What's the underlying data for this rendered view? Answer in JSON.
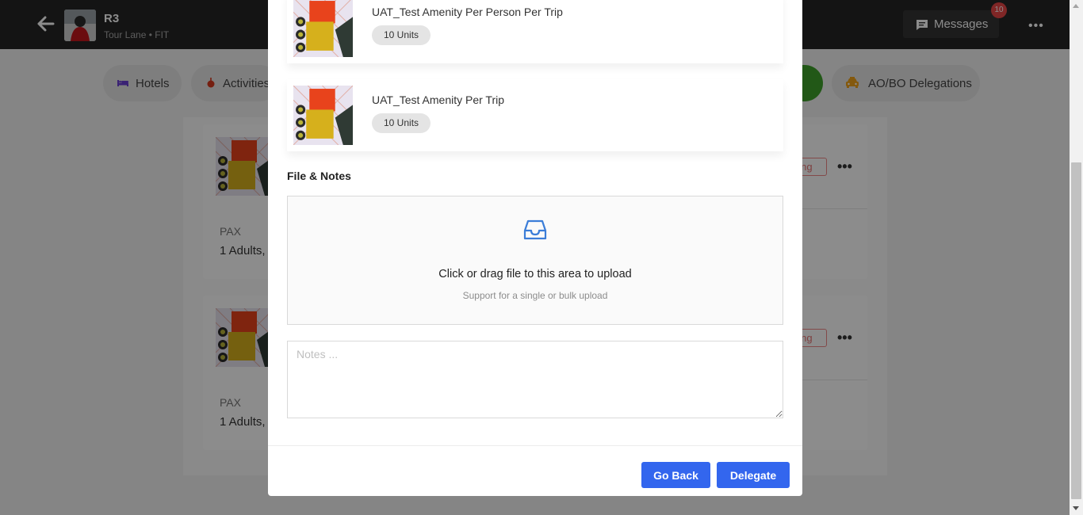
{
  "header": {
    "title": "R3",
    "subtitle": "Tour Lane • FIT",
    "messages_label": "Messages",
    "messages_count": "10"
  },
  "tabs": [
    {
      "label": "Hotels",
      "icon": "bed-icon"
    },
    {
      "label": "Activities",
      "icon": "activity-icon"
    },
    {
      "label": "",
      "icon": "green-tab"
    },
    {
      "label": "AO/BO Delegations",
      "icon": "taxi-icon"
    }
  ],
  "cards": [
    {
      "pax_label": "PAX",
      "pax_value": "1 Adults,",
      "status": "ding"
    },
    {
      "pax_label": "PAX",
      "pax_value": "1 Adults,",
      "status": "ding"
    }
  ],
  "modal": {
    "items": [
      {
        "name": "UAT_Test Amenity Per Person Per Trip",
        "units": "10 Units"
      },
      {
        "name": "UAT_Test Amenity Per Trip",
        "units": "10 Units"
      }
    ],
    "section_title": "File & Notes",
    "upload": {
      "title": "Click or drag file to this area to upload",
      "hint": "Support for a single or bulk upload"
    },
    "notes_placeholder": "Notes ...",
    "go_back_label": "Go Back",
    "delegate_label": "Delegate"
  },
  "colors": {
    "primary": "#3366ee",
    "topbar": "#262626",
    "badge": "#e84545",
    "green_tab": "#3fa12b",
    "upload_icon": "#3b7dd8"
  }
}
